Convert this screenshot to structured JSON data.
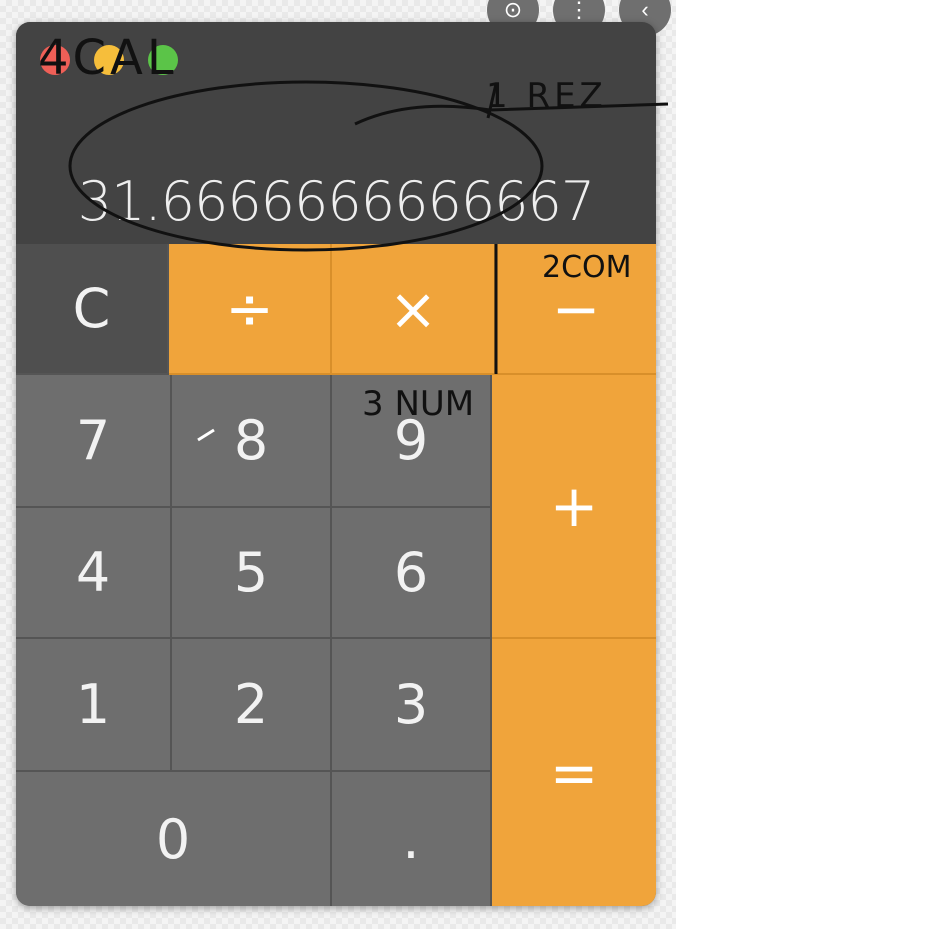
{
  "viewer": {
    "buttons": [
      {
        "icon": "lens-icon",
        "glyph": "⊙"
      },
      {
        "icon": "more-icon",
        "glyph": "⋮"
      },
      {
        "icon": "back-icon",
        "glyph": "‹"
      }
    ]
  },
  "calculator": {
    "display": "31.6666666666667",
    "keys": {
      "clear": "C",
      "divide": "÷",
      "multiply": "×",
      "subtract": "−",
      "seven": "7",
      "eight": "8",
      "nine": "9",
      "add": "+",
      "four": "4",
      "five": "5",
      "six": "6",
      "one": "1",
      "two": "2",
      "three": "3",
      "equals": "=",
      "zero": "0",
      "decimal": "."
    },
    "colors": {
      "operator": "#f0a43b",
      "number": "#6e6e6e",
      "clear": "#4f4f4f",
      "titlebar": "#434343"
    }
  },
  "annotations": {
    "title": "4CAL",
    "result": "1 REZ",
    "commands": "2COM",
    "numbers": "3 NUM"
  }
}
